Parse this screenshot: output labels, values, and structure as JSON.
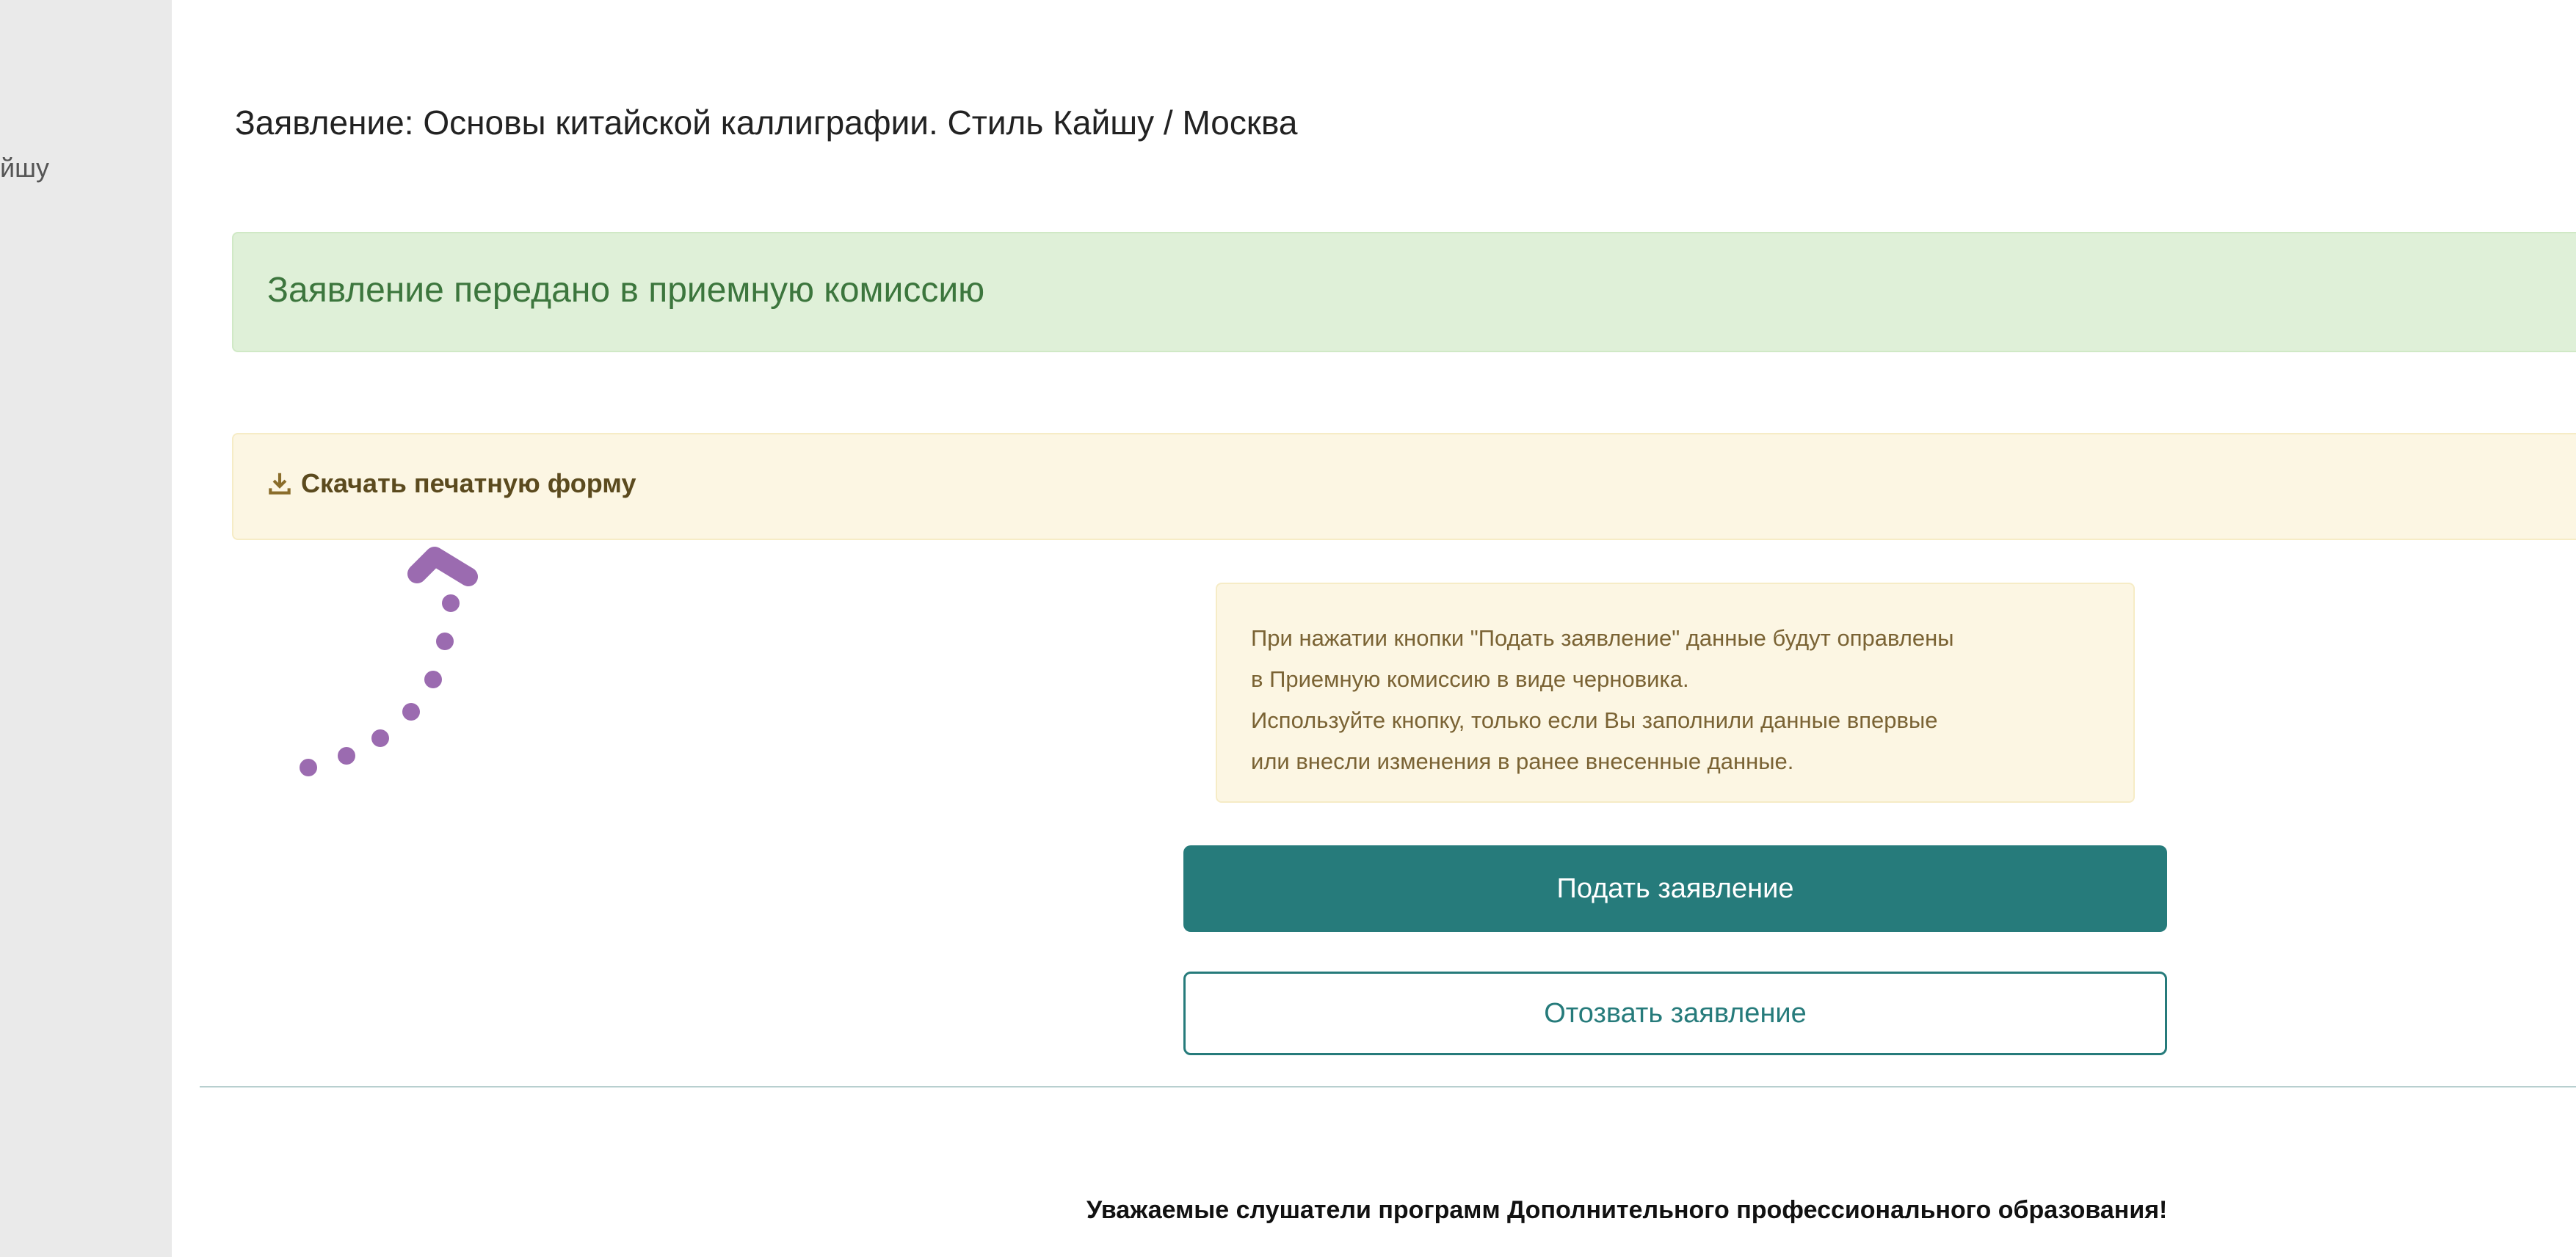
{
  "sidebar": {
    "items": [
      {
        "label": "йшу"
      }
    ],
    "background": "#eaeaea"
  },
  "page": {
    "title": "Заявление: Основы китайской каллиграфии. Стиль Кайшу / Москва"
  },
  "status_alert": {
    "text": "Заявление передано в приемную комиссию",
    "color": "#3c763d",
    "background": "#dff0d8"
  },
  "download": {
    "label": "Скачать печатную форму",
    "icon": "download-icon"
  },
  "annotation": {
    "icon": "dotted-arrow-icon",
    "color": "#9b6bb0"
  },
  "info_note": {
    "lines": [
      "При нажатии кнопки \"Подать заявление\" данные будут оправлены",
      "в Приемную комиссию в виде черновика.",
      "Используйте кнопку, только если Вы заполнили данные впервые",
      "или внесли изменения в ранее внесенные данные."
    ]
  },
  "actions": {
    "submit_label": "Подать заявление",
    "withdraw_label": "Отозвать заявление",
    "accent": "#267b7b"
  },
  "footer": {
    "notice": "Уважаемые слушатели программ Дополнительного профессионального образования!"
  }
}
